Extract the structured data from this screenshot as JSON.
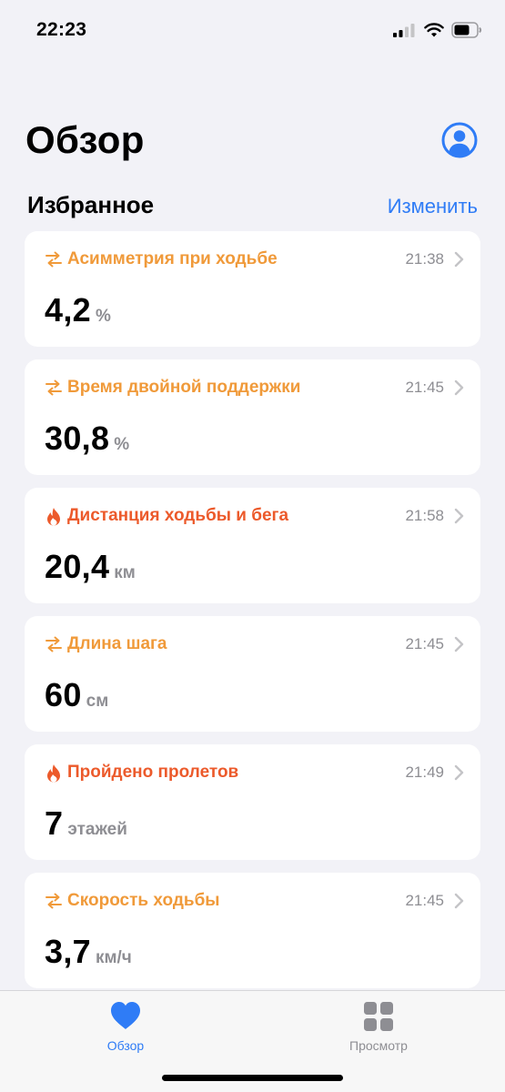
{
  "status_bar": {
    "time": "22:23"
  },
  "header": {
    "title": "Обзор",
    "profile_icon": "person-circle-icon"
  },
  "favorites": {
    "title": "Избранное",
    "edit_label": "Изменить"
  },
  "colors": {
    "accent": "#2f7cf6",
    "mobility": "#f09a3a",
    "activity": "#ec5a2b",
    "secondary": "#8e8e93"
  },
  "cards": [
    {
      "icon": "arrows-mobility-icon",
      "title": "Асимметрия при ходьбе",
      "time": "21:38",
      "value": "4,2",
      "unit": "%"
    },
    {
      "icon": "arrows-mobility-icon",
      "title": "Время двойной поддержки",
      "time": "21:45",
      "value": "30,8",
      "unit": "%"
    },
    {
      "icon": "flame-icon",
      "title": "Дистанция ходьбы и бега",
      "time": "21:58",
      "value": "20,4",
      "unit": "км"
    },
    {
      "icon": "arrows-mobility-icon",
      "title": "Длина шага",
      "time": "21:45",
      "value": "60",
      "unit": "см"
    },
    {
      "icon": "flame-icon",
      "title": "Пройдено пролетов",
      "time": "21:49",
      "value": "7",
      "unit": "этажей"
    },
    {
      "icon": "arrows-mobility-icon",
      "title": "Скорость ходьбы",
      "time": "21:45",
      "value": "3,7",
      "unit": "км/ч"
    }
  ],
  "tab_bar": {
    "summary_label": "Обзор",
    "browse_label": "Просмотр"
  }
}
